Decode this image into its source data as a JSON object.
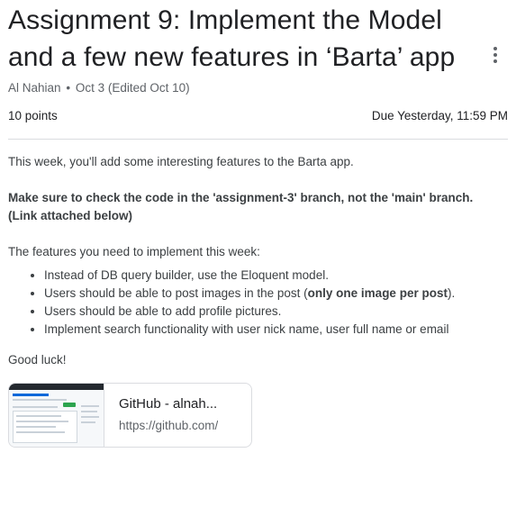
{
  "assignment": {
    "title": "Assignment 9: Implement the Model and a few new features in ‘Barta’ app",
    "author": "Al Nahian",
    "separator": "•",
    "date": "Oct 3 (Edited Oct 10)",
    "points": "10 points",
    "due": "Due Yesterday, 11:59 PM"
  },
  "body": {
    "intro": "This week, you'll add some interesting features to the Barta app.",
    "note_line1": "Make sure to check the code in the 'assignment-3' branch, not the 'main' branch.",
    "note_line2": "(Link attached below)",
    "features_intro": "The features you need to implement this week:",
    "features": [
      "Instead of DB query builder, use the Eloquent model.",
      "Users should be able to post images in the post (",
      "only one image per post",
      ").",
      "Users should be able to add profile pictures.",
      "Implement search functionality with user nick name, user full name or email"
    ],
    "closing": "Good luck!"
  },
  "attachment": {
    "title": "GitHub - alnah...",
    "url": "https://github.com/"
  },
  "icons": {
    "more": "more-vert-icon"
  }
}
